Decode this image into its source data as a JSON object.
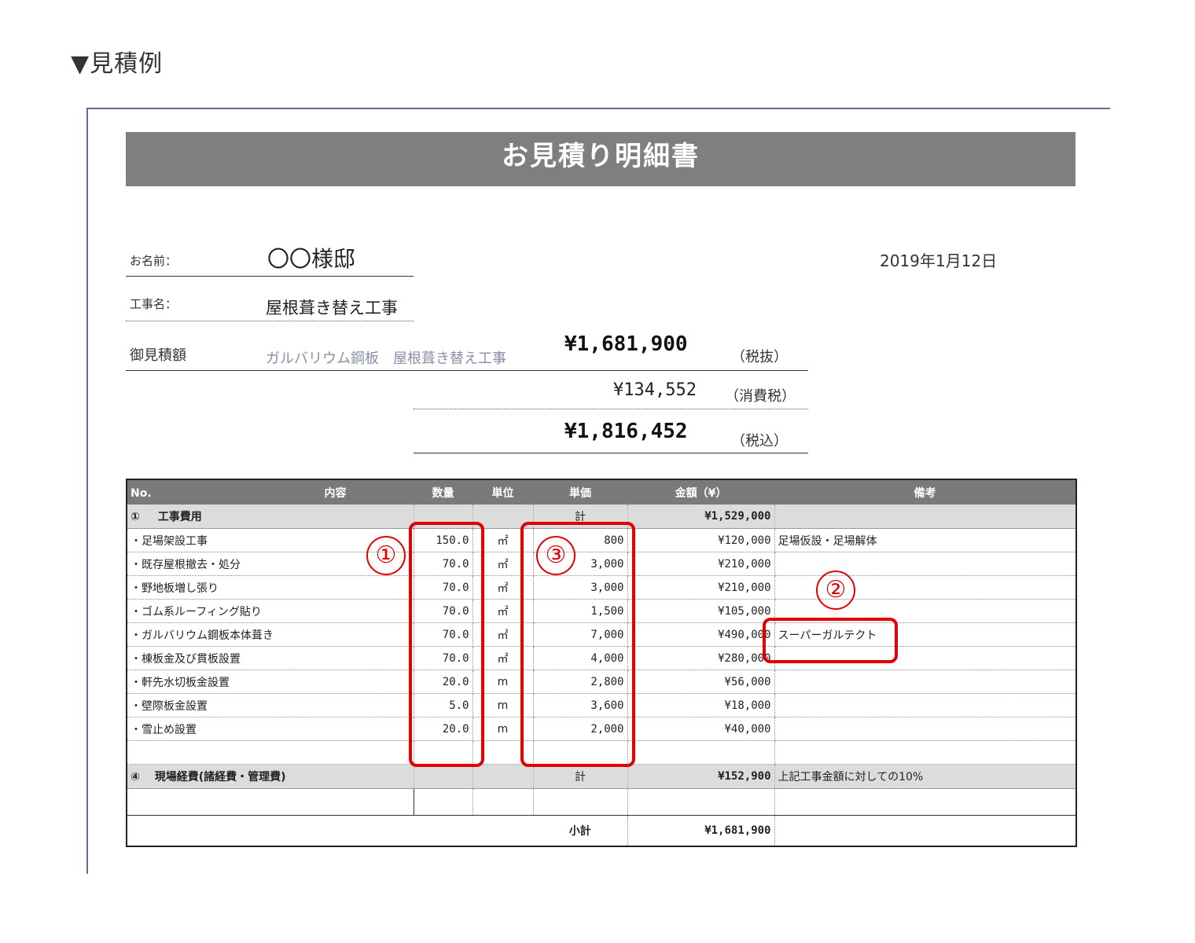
{
  "heading": "▼見積例",
  "title": "お見積り明細書",
  "customer": {
    "label": "お名前：",
    "value": "〇〇様邸"
  },
  "date": "2019年1月12日",
  "project": {
    "label": "工事名：",
    "value": "屋根葺き替え工事"
  },
  "estimate": {
    "label": "御見積額",
    "desc": "ガルバリウム鋼板　屋根葺き替え工事",
    "excl_tax": "¥1,681,900",
    "excl_label": "（税抜）",
    "tax": "¥134,552",
    "tax_label": "（消費税）",
    "incl_tax": "¥1,816,452",
    "incl_label": "（税込）"
  },
  "table": {
    "headers": [
      "No.",
      "内容",
      "数量",
      "単位",
      "単価",
      "金額（¥）",
      "備考"
    ],
    "section1": {
      "no": "①",
      "name": "工事費用",
      "kei": "計",
      "total": "¥1,529,000"
    },
    "items": [
      {
        "name": "・足場架設工事",
        "qty": "150.0",
        "unit": "㎡",
        "price": "800",
        "amount": "¥120,000",
        "note": "足場仮設・足場解体"
      },
      {
        "name": "・既存屋根撤去・処分",
        "qty": "70.0",
        "unit": "㎡",
        "price": "3,000",
        "amount": "¥210,000",
        "note": ""
      },
      {
        "name": "・野地板増し張り",
        "qty": "70.0",
        "unit": "㎡",
        "price": "3,000",
        "amount": "¥210,000",
        "note": ""
      },
      {
        "name": "・ゴム系ルーフィング貼り",
        "qty": "70.0",
        "unit": "㎡",
        "price": "1,500",
        "amount": "¥105,000",
        "note": ""
      },
      {
        "name": "・ガルバリウム鋼板本体葺き",
        "qty": "70.0",
        "unit": "㎡",
        "price": "7,000",
        "amount": "¥490,000",
        "note": "スーパーガルテクト"
      },
      {
        "name": "・棟板金及び貫板設置",
        "qty": "70.0",
        "unit": "㎡",
        "price": "4,000",
        "amount": "¥280,000",
        "note": ""
      },
      {
        "name": "・軒先水切板金設置",
        "qty": "20.0",
        "unit": "m",
        "price": "2,800",
        "amount": "¥56,000",
        "note": ""
      },
      {
        "name": "・壁際板金設置",
        "qty": "5.0",
        "unit": "m",
        "price": "3,600",
        "amount": "¥18,000",
        "note": ""
      },
      {
        "name": "・雪止め設置",
        "qty": "20.0",
        "unit": "m",
        "price": "2,000",
        "amount": "¥40,000",
        "note": ""
      }
    ],
    "section4": {
      "no": "④",
      "name": "現場経費(諸経費・管理費)",
      "kei": "計",
      "total": "¥152,900",
      "note": "上記工事金額に対しての10%"
    },
    "subtotal": {
      "label": "小計",
      "value": "¥1,681,900"
    }
  },
  "annotations": {
    "one": "①",
    "two": "②",
    "three": "③"
  }
}
